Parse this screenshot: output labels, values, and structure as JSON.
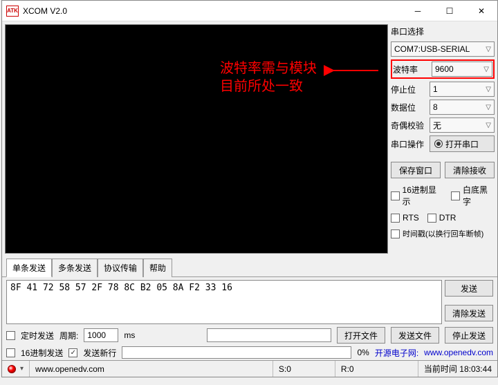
{
  "window": {
    "title": "XCOM V2.0",
    "icon_text": "ATK XCOM"
  },
  "annotation": {
    "line1": "波特率需与模块",
    "line2": "目前所处一致"
  },
  "side": {
    "port_select_label": "串口选择",
    "port_value": "COM7:USB-SERIAL",
    "baud_label": "波特率",
    "baud_value": "9600",
    "stop_label": "停止位",
    "stop_value": "1",
    "data_label": "数据位",
    "data_value": "8",
    "parity_label": "奇偶校验",
    "parity_value": "无",
    "op_label": "串口操作",
    "open_port_btn": "打开串口",
    "save_window_btn": "保存窗口",
    "clear_recv_btn": "清除接收",
    "hex_display": "16进制显示",
    "white_bg": "白底黑字",
    "rts": "RTS",
    "dtr": "DTR",
    "timestamp": "时间戳(以换行回车断帧)"
  },
  "tabs": {
    "single": "单条发送",
    "multi": "多条发送",
    "protocol": "协议传输",
    "help": "帮助"
  },
  "send_text": "8F 41 72 58 57 2F 78 8C B2 05 8A F2 33 16",
  "buttons": {
    "send": "发送",
    "clear_send": "清除发送",
    "open_file": "打开文件",
    "send_file": "发送文件",
    "stop_send": "停止发送"
  },
  "bottom": {
    "timed_send": "定时发送",
    "period_label": "周期:",
    "period_value": "1000",
    "period_unit": "ms",
    "hex_send": "16进制发送",
    "send_newline": "发送新行",
    "progress": "0%",
    "site_label": "开源电子网:",
    "site_url": "www.openedv.com"
  },
  "status": {
    "url": "www.openedv.com",
    "sent": "S:0",
    "recv": "R:0",
    "time_label": "当前时间",
    "time_value": "18:03:44"
  }
}
